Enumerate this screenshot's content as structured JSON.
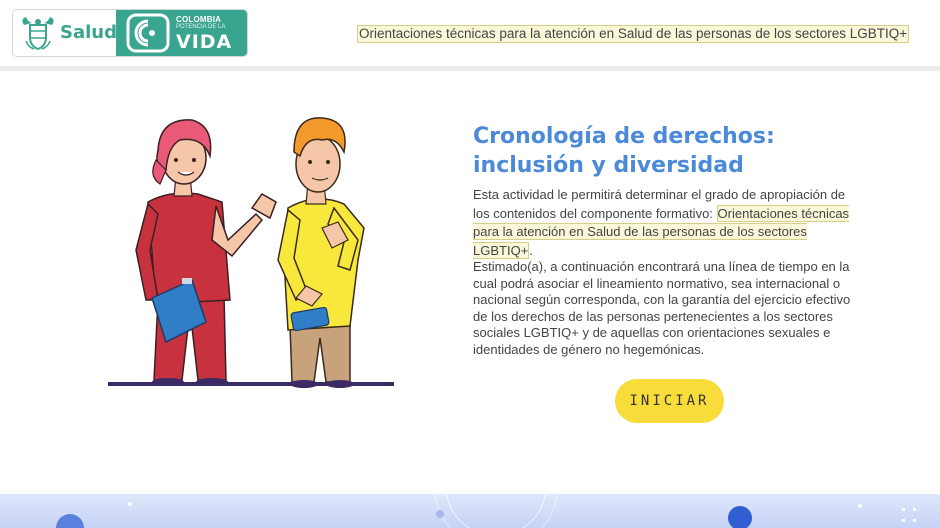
{
  "header": {
    "logo_salud": "Salud",
    "logo_colombia_line1": "COLOMBIA",
    "logo_colombia_line2": "POTENCIA DE LA",
    "logo_colombia_line3": "VIDA",
    "course_link": "Orientaciones técnicas para la atención en Salud de las personas de los sectores LGBTIQ+"
  },
  "main": {
    "title_line1": "Cronología de derechos:",
    "title_line2": "inclusión y diversidad",
    "para1_before": "Esta actividad le permitirá determinar el grado de apropiación de los contenidos del componente formativo:",
    "para1_link": "Orientaciones técnicas para la atención en Salud de las personas de los sectores LGBTIQ+",
    "para1_after": ".",
    "para2": "Estimado(a), a continuación encontrará una línea de tiempo en la cual podrá asociar el lineamiento normativo, sea internacional o nacional según corresponda, con la garantía del ejercicio efectivo de los derechos de las personas pertenecientes a los sectores sociales LGBTIQ+ y de aquellas con orientaciones sexuales e identidades de género no hegemónicas.",
    "start_button": "INICIAR"
  },
  "colors": {
    "accent_green": "#3aa58f",
    "title_blue": "#4a8ad8",
    "button_yellow": "#f7dc3a",
    "highlight_bg": "#fbf8d9"
  },
  "icons": [
    "coat-of-arms-icon",
    "colombia-wave-icon",
    "fullscreen-icon"
  ]
}
